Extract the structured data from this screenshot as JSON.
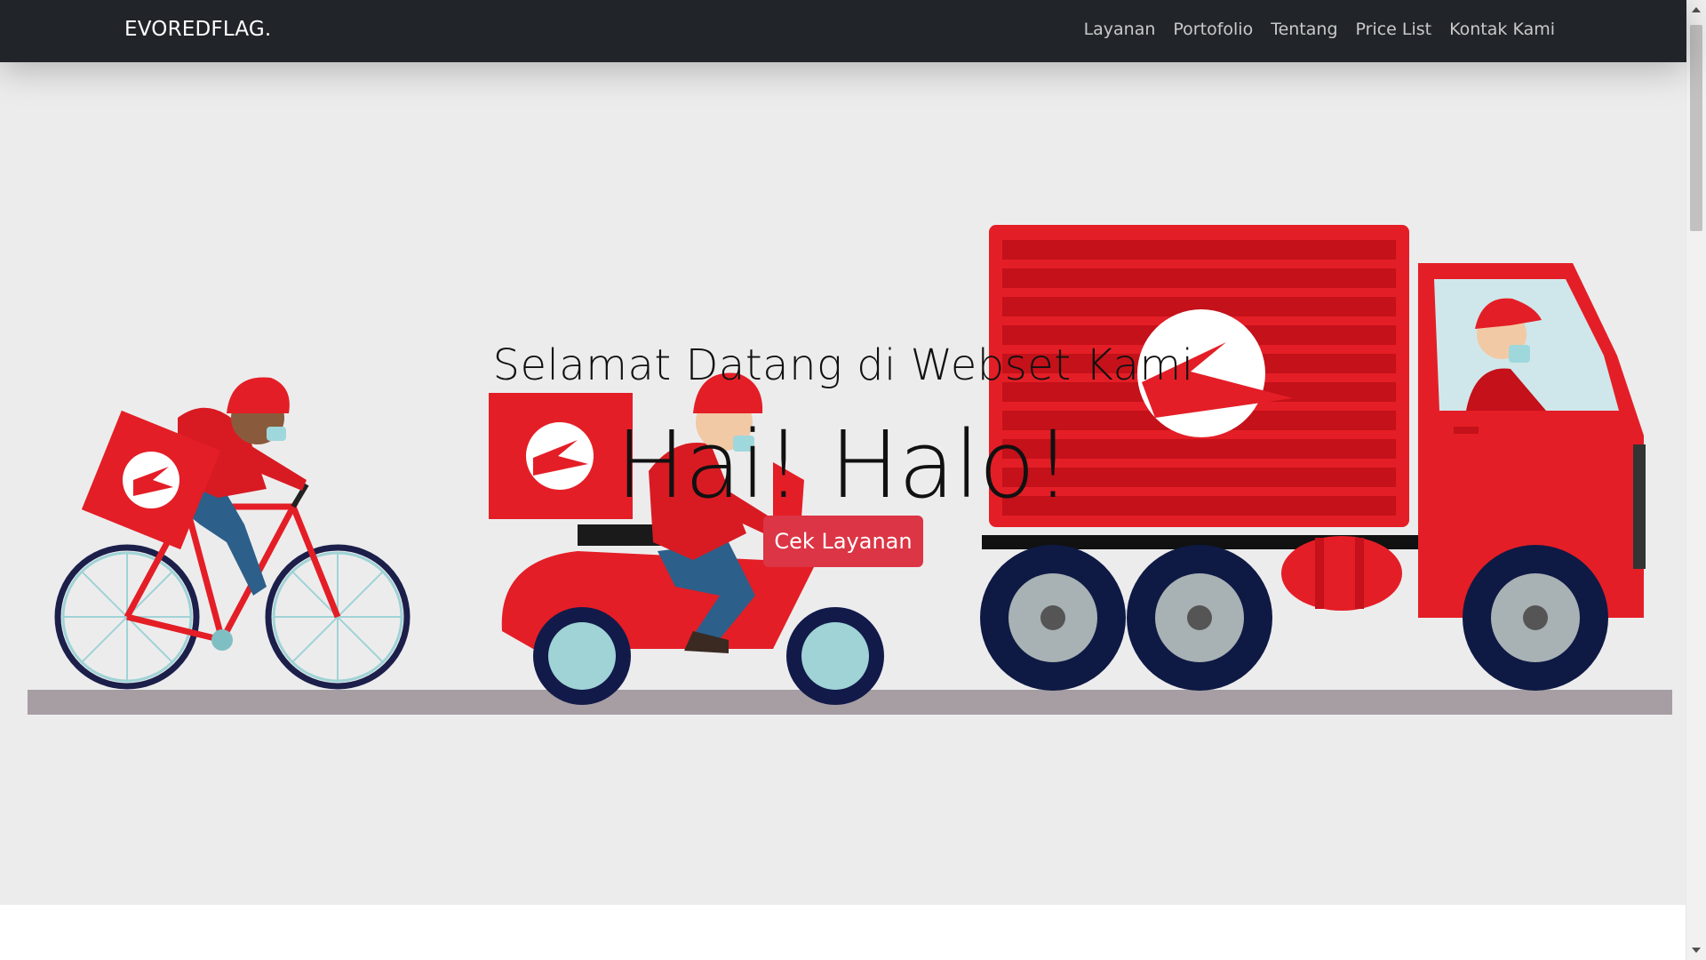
{
  "navbar": {
    "brand": "EVOREDFLAG.",
    "links": [
      "Layanan",
      "Portofolio",
      "Tentang",
      "Price List",
      "Kontak Kami"
    ]
  },
  "hero": {
    "subtitle": "Selamat Datang di Webset Kami",
    "title": "Hai! Halo!",
    "button_label": "Cek Layanan",
    "illustration": "delivery-vehicles-illustration"
  },
  "colors": {
    "navbar_bg": "#212529",
    "hero_bg": "#edeced",
    "accent_red": "#dc3545",
    "vehicle_red": "#e50914"
  }
}
